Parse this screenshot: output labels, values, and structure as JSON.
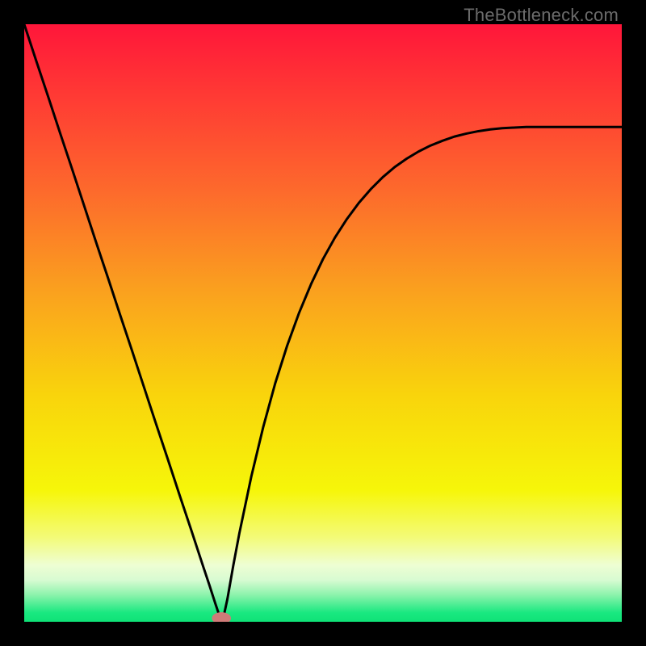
{
  "watermark": "TheBottleneck.com",
  "colors": {
    "frame": "#000000",
    "curve": "#000000",
    "marker_fill": "#cf7b78",
    "gradient_stops": [
      {
        "offset": 0.0,
        "color": "#ff163a"
      },
      {
        "offset": 0.12,
        "color": "#ff3a34"
      },
      {
        "offset": 0.28,
        "color": "#fd6a2c"
      },
      {
        "offset": 0.45,
        "color": "#faa21e"
      },
      {
        "offset": 0.62,
        "color": "#f9d40c"
      },
      {
        "offset": 0.78,
        "color": "#f6f609"
      },
      {
        "offset": 0.86,
        "color": "#f3fb7a"
      },
      {
        "offset": 0.905,
        "color": "#eefed3"
      },
      {
        "offset": 0.93,
        "color": "#d8fbd2"
      },
      {
        "offset": 0.955,
        "color": "#8cf3ac"
      },
      {
        "offset": 0.985,
        "color": "#19e880"
      },
      {
        "offset": 1.0,
        "color": "#0fe277"
      }
    ]
  },
  "chart_data": {
    "type": "line",
    "title": "",
    "xlabel": "",
    "ylabel": "",
    "xlim": [
      0,
      100
    ],
    "ylim": [
      0,
      100
    ],
    "grid": false,
    "legend": false,
    "minimum_x": 33,
    "marker": {
      "x": 33,
      "y": 0.6,
      "rx": 1.6,
      "ry": 1.0
    },
    "x": [
      0,
      2,
      4,
      6,
      8,
      10,
      12,
      14,
      16,
      18,
      20,
      22,
      24,
      26,
      28,
      30,
      31,
      32,
      32.5,
      33,
      33.5,
      34,
      35,
      36,
      38,
      40,
      42,
      44,
      46,
      48,
      50,
      52,
      54,
      56,
      58,
      60,
      62,
      64,
      66,
      68,
      70,
      72,
      74,
      76,
      78,
      80,
      82,
      84,
      86,
      88,
      90,
      92,
      94,
      96,
      98,
      100
    ],
    "y": [
      100,
      93.9,
      87.9,
      81.8,
      75.8,
      69.7,
      63.6,
      57.6,
      51.5,
      45.5,
      39.4,
      33.3,
      27.3,
      21.2,
      15.2,
      9.1,
      6.1,
      3.0,
      1.5,
      0.0,
      1.5,
      3.8,
      9.5,
      14.8,
      24.3,
      32.6,
      39.9,
      46.2,
      51.7,
      56.5,
      60.7,
      64.3,
      67.4,
      70.1,
      72.4,
      74.4,
      76.1,
      77.5,
      78.7,
      79.7,
      80.5,
      81.2,
      81.7,
      82.1,
      82.4,
      82.6,
      82.7,
      82.8,
      82.8,
      82.8,
      82.8,
      82.8,
      82.8,
      82.8,
      82.8,
      82.8
    ]
  }
}
